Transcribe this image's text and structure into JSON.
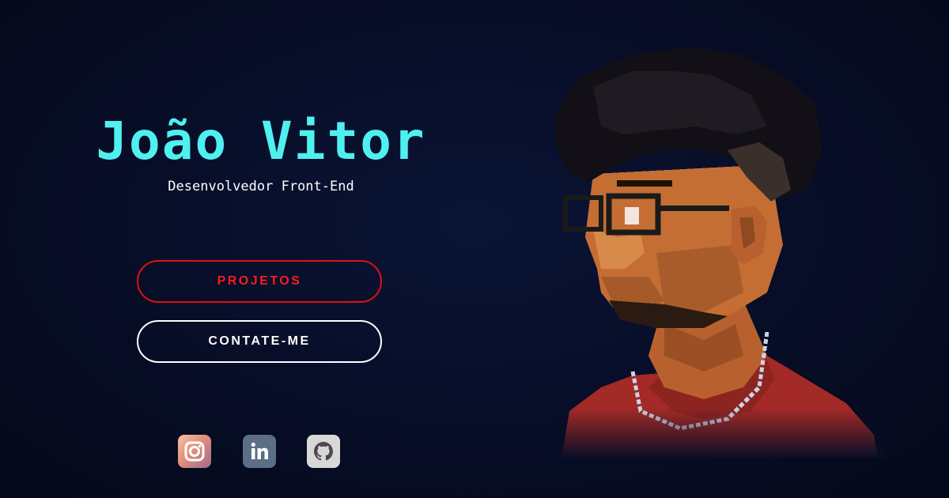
{
  "hero": {
    "name": "João Vitor",
    "role": "Desenvolvedor Front-End"
  },
  "actions": {
    "projects_label": "PROJETOS",
    "contact_label": "CONTATE-ME"
  },
  "social": [
    {
      "icon": "instagram-icon"
    },
    {
      "icon": "linkedin-icon"
    },
    {
      "icon": "github-icon"
    }
  ],
  "colors": {
    "background": "#070d26",
    "name_accent": "#4ff0f0",
    "projects_accent": "#ff1a1a",
    "contact_border": "#ffffff"
  }
}
